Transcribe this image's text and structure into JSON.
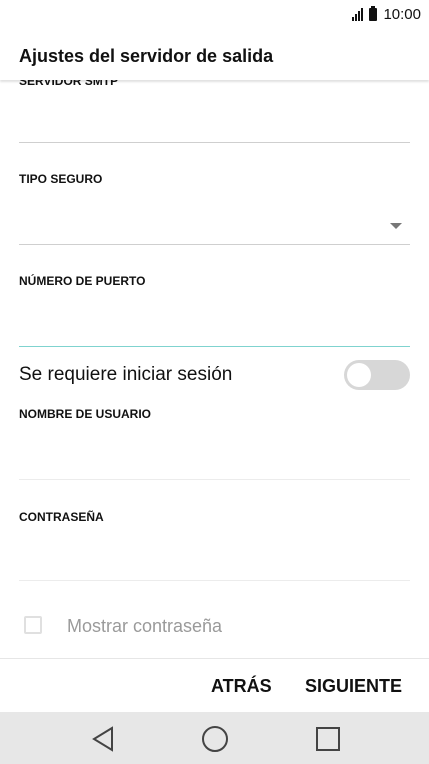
{
  "status": {
    "time": "10:00"
  },
  "header": {
    "title": "Ajustes del servidor de salida"
  },
  "fields": {
    "smtp_server_label": "SERVIDOR SMTP",
    "security_type_label": "TIPO SEGURO",
    "security_type_value": "",
    "port_label": "NÚMERO DE PUERTO",
    "port_value": "",
    "require_signin_label": "Se requiere iniciar sesión",
    "require_signin_on": false,
    "username_label": "NOMBRE DE USUARIO",
    "username_value": "",
    "password_label": "CONTRASEÑA",
    "password_value": "",
    "show_password_label": "Mostrar contraseña"
  },
  "actions": {
    "back_label": "ATRÁS",
    "next_label": "SIGUIENTE"
  },
  "icons": {
    "signal": "signal-icon",
    "battery": "battery-icon",
    "dropdown": "dropdown-arrow-icon",
    "nav_back": "nav-back-icon",
    "nav_home": "nav-home-icon",
    "nav_recent": "nav-recent-icon"
  }
}
